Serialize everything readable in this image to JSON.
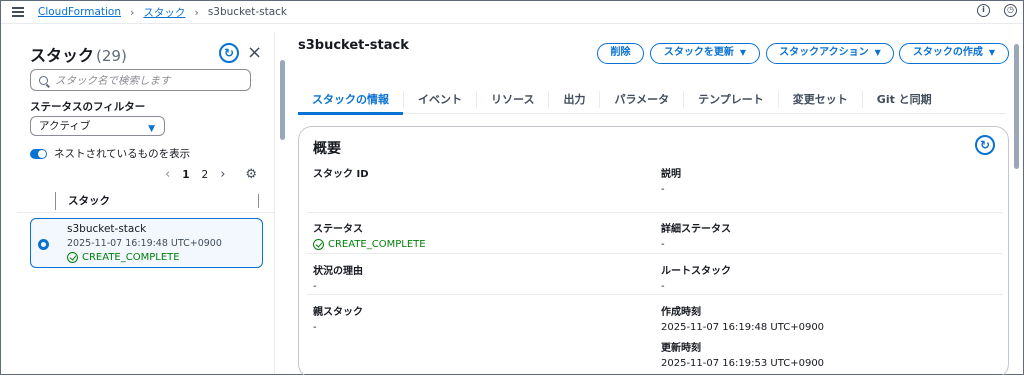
{
  "breadcrumb": {
    "root": "CloudFormation",
    "stacks": "スタック",
    "current": "s3bucket-stack"
  },
  "top_icons": {
    "info": "i",
    "timer": "◷"
  },
  "left_panel": {
    "title": "スタック",
    "count": "(29)",
    "close": "×",
    "refresh": "↻",
    "search_placeholder": "スタック名で検索します",
    "filter_label": "ステータスのフィルター",
    "filter_value": "アクティブ",
    "nested_toggle_label": "ネストされているものを表示",
    "pager": {
      "page1": "1",
      "page2": "2",
      "prev": "‹",
      "next": "›",
      "settings": "⚙"
    },
    "column_header": "スタック",
    "selected_stack": {
      "name": "s3bucket-stack",
      "time": "2025-11-07 16:19:48 UTC+0900",
      "status": "CREATE_COMPLETE"
    }
  },
  "main": {
    "title": "s3bucket-stack",
    "buttons": {
      "delete": "削除",
      "update": "スタックを更新",
      "actions": "スタックアクション",
      "create": "スタックの作成",
      "dropdown_caret": "▼"
    },
    "tabs": [
      "スタックの情報",
      "イベント",
      "リソース",
      "出力",
      "パラメータ",
      "テンプレート",
      "変更セット",
      "Git と同期"
    ],
    "overview": {
      "title": "概要",
      "stack_id_label": "スタック ID",
      "stack_id_value": "",
      "description_label": "説明",
      "description_value": "-",
      "status_label": "ステータス",
      "status_value": "CREATE_COMPLETE",
      "detailed_status_label": "詳細ステータス",
      "detailed_status_value": "-",
      "status_reason_label": "状況の理由",
      "status_reason_value": "-",
      "root_stack_label": "ルートスタック",
      "root_stack_value": "-",
      "parent_stack_label": "親スタック",
      "parent_stack_value": "-",
      "created_label": "作成時刻",
      "created_value": "2025-11-07 16:19:48 UTC+0900",
      "updated_label": "更新時刻",
      "updated_value": "2025-11-07 16:19:53 UTC+0900"
    }
  },
  "colors": {
    "accent": "#0972d3",
    "success": "#037f0c"
  }
}
